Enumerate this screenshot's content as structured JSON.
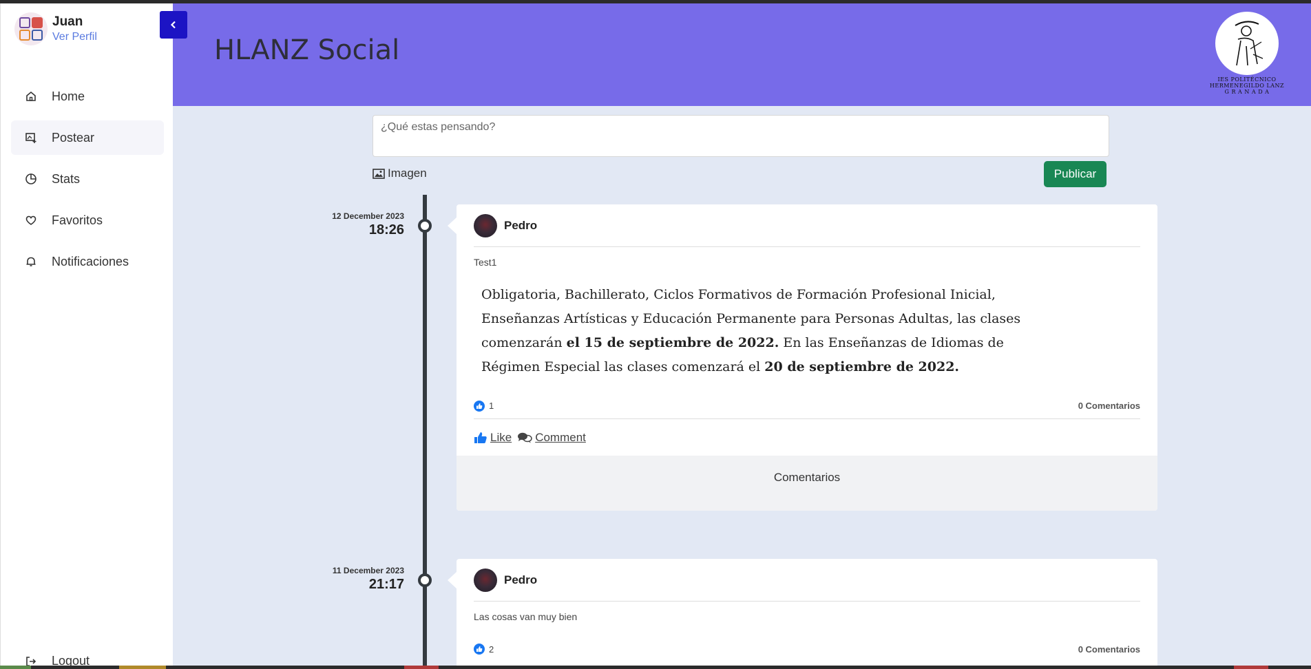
{
  "user": {
    "name": "Juan",
    "profile_link": "Ver Perfil"
  },
  "sidebar": {
    "items": [
      {
        "label": "Home",
        "icon": "home-icon"
      },
      {
        "label": "Postear",
        "icon": "post-icon",
        "active": true
      },
      {
        "label": "Stats",
        "icon": "stats-icon"
      },
      {
        "label": "Favoritos",
        "icon": "heart-icon"
      },
      {
        "label": "Notificaciones",
        "icon": "bell-icon"
      }
    ],
    "logout": "Logout"
  },
  "header": {
    "title": "HLANZ Social",
    "logo_line1": "IES POLITÉCNICO",
    "logo_line2": "HERMENEGILDO LANZ",
    "logo_line3": "G R A N A D A"
  },
  "composer": {
    "placeholder": "¿Qué estas pensando?",
    "image_label": "Imagen",
    "publish_label": "Publicar"
  },
  "posts": [
    {
      "date": "12 December 2023",
      "time": "18:26",
      "author": "Pedro",
      "subtitle": "Test1",
      "body_1": "Obligatoria, Bachillerato, Ciclos Formativos de Formación Profesional Inicial, Enseñanzas Artísticas y Educación Permanente para Personas Adultas, las clases comenzarán ",
      "body_bold_1": "el 15 de septiembre de 2022.",
      "body_2": " En las Enseñanzas de Idiomas de Régimen Especial las clases comenzará el ",
      "body_bold_2": "20 de septiembre de 2022.",
      "likes": "1",
      "comments": "0 Comentarios",
      "like_label": "Like",
      "comment_label": "Comment",
      "comments_title": "Comentarios"
    },
    {
      "date": "11 December 2023",
      "time": "21:17",
      "author": "Pedro",
      "subtitle": "Las cosas van muy bien",
      "likes": "2",
      "comments": "0 Comentarios"
    }
  ],
  "colors": {
    "header": "#776be9",
    "accent": "#1c14c4",
    "publish": "#198754",
    "background": "#e2e8f4"
  }
}
